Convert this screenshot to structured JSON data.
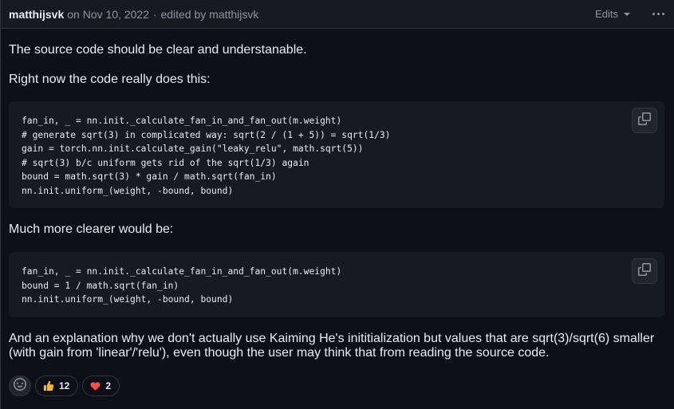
{
  "header": {
    "author": "matthijsvk",
    "date_prefix": "on Nov 10, 2022",
    "separator": "·",
    "edited_by": "edited by matthijsvk",
    "edits_label": "Edits"
  },
  "paragraphs": {
    "p1": "The source code should be clear and understanable.",
    "p2": "Right now the code really does this:",
    "p3": "Much more clearer would be:",
    "p4": "And an explanation why we don't actually use Kaiming He's inititialization but values that are sqrt(3)/sqrt(6) smaller (with gain from 'linear'/'relu'), even though the user may think that from reading the source code."
  },
  "code_blocks": [
    {
      "text": "fan_in, _ = nn.init._calculate_fan_in_and_fan_out(m.weight)\n# generate sqrt(3) in complicated way: sqrt(2 / (1 + 5)) = sqrt(1/3)\ngain = torch.nn.init.calculate_gain(\"leaky_relu\", math.sqrt(5))\n# sqrt(3) b/c uniform gets rid of the sqrt(1/3) again\nbound = math.sqrt(3) * gain / math.sqrt(fan_in)\nnn.init.uniform_(weight, -bound, bound)"
    },
    {
      "text": "fan_in, _ = nn.init._calculate_fan_in_and_fan_out(m.weight)\nbound = 1 / math.sqrt(fan_in)\nnn.init.uniform_(weight, -bound, bound)"
    }
  ],
  "icons": {
    "copy": "copy-icon",
    "smiley": "smiley-icon",
    "kebab": "kebab-horizontal-icon",
    "caret": "triangle-down-icon"
  },
  "reactions": [
    {
      "emoji": "👍",
      "name": "thumbs-up",
      "count": "12"
    },
    {
      "emoji": "❤",
      "name": "heart",
      "count": "2"
    }
  ],
  "colors": {
    "background": "#0d1117",
    "header_bg": "#161b22",
    "code_bg": "#161b22",
    "border": "#30363d",
    "muted_text": "#8d96a0",
    "text": "#e6edf3",
    "heart": "#f85149",
    "thumbs": "#f5b82e"
  }
}
